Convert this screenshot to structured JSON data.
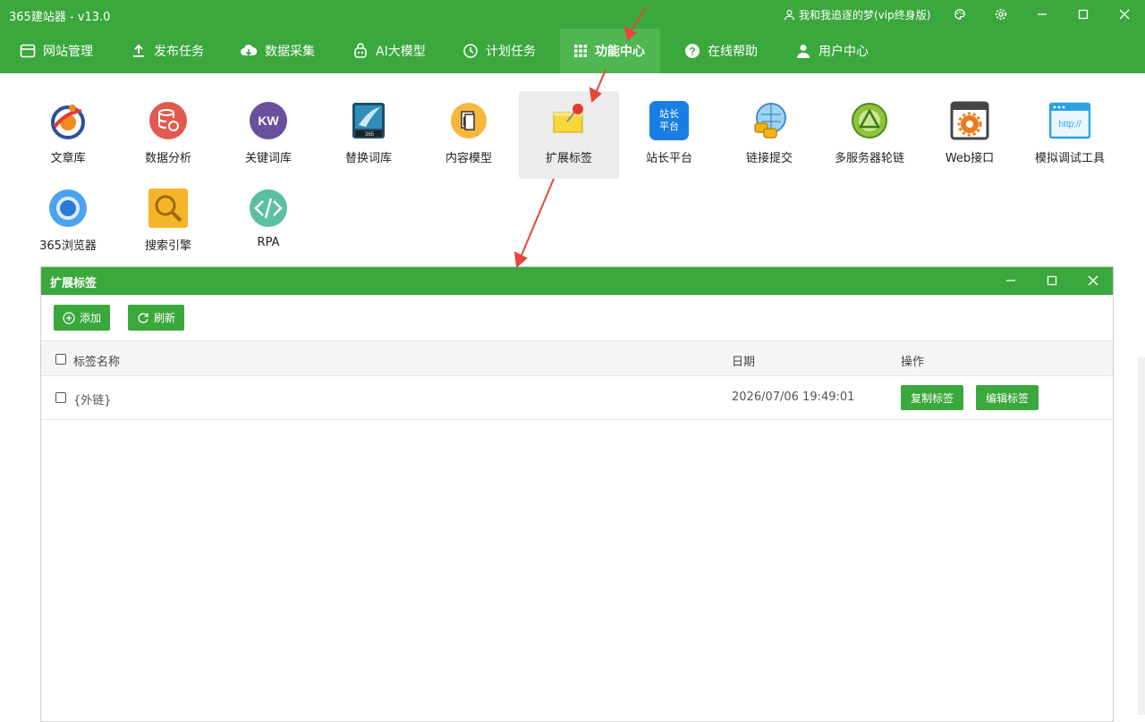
{
  "window": {
    "title": "365建站器 - v13.0",
    "user": "我和我追逐的梦(vip终身版)",
    "user_icon": "user-icon",
    "controls": [
      "skin-icon",
      "settings-icon",
      "minimize-icon",
      "maximize-icon",
      "close-icon"
    ]
  },
  "nav": {
    "items": [
      {
        "label": "网站管理",
        "icon": "browser-window-icon"
      },
      {
        "label": "发布任务",
        "icon": "upload-icon"
      },
      {
        "label": "数据采集",
        "icon": "cloud-download-icon"
      },
      {
        "label": "AI大模型",
        "icon": "robot-icon"
      },
      {
        "label": "计划任务",
        "icon": "clock-icon"
      },
      {
        "label": "功能中心",
        "icon": "grid-icon",
        "active": true
      },
      {
        "label": "在线帮助",
        "icon": "help-icon"
      },
      {
        "label": "用户中心",
        "icon": "person-icon"
      }
    ]
  },
  "tools": [
    {
      "label": "文章库",
      "icon": "article-library-icon"
    },
    {
      "label": "数据分析",
      "icon": "data-analysis-icon"
    },
    {
      "label": "关键词库",
      "icon": "keyword-library-icon",
      "badge": "KW"
    },
    {
      "label": "替换词库",
      "icon": "replace-library-icon",
      "badge": "365"
    },
    {
      "label": "内容模型",
      "icon": "content-model-icon"
    },
    {
      "label": "扩展标签",
      "icon": "extended-tag-icon",
      "selected": true
    },
    {
      "label": "站长平台",
      "icon": "webmaster-platform-icon",
      "badge_lines": [
        "站长",
        "平台"
      ]
    },
    {
      "label": "链接提交",
      "icon": "link-submit-icon"
    },
    {
      "label": "多服务器轮链",
      "icon": "multi-server-icon"
    },
    {
      "label": "Web接口",
      "icon": "web-api-icon"
    },
    {
      "label": "模拟调试工具",
      "icon": "debug-tool-icon",
      "badge": "http://"
    },
    {
      "label": "365浏览器",
      "icon": "browser-icon"
    },
    {
      "label": "搜索引擎",
      "icon": "search-engine-icon"
    },
    {
      "label": "RPA",
      "icon": "rpa-code-icon"
    }
  ],
  "dialog": {
    "title": "扩展标签",
    "buttons": {
      "add": "添加",
      "refresh": "刷新"
    },
    "table": {
      "columns": [
        "标签名称",
        "日期",
        "操作"
      ],
      "rows": [
        {
          "name": "{外链}",
          "date": "2026/07/06 19:49:01",
          "actions": [
            "复制标签",
            "编辑标签"
          ]
        }
      ]
    }
  },
  "colors": {
    "primary": "#3aa83c",
    "annotation_arrow": "#e8453c"
  }
}
